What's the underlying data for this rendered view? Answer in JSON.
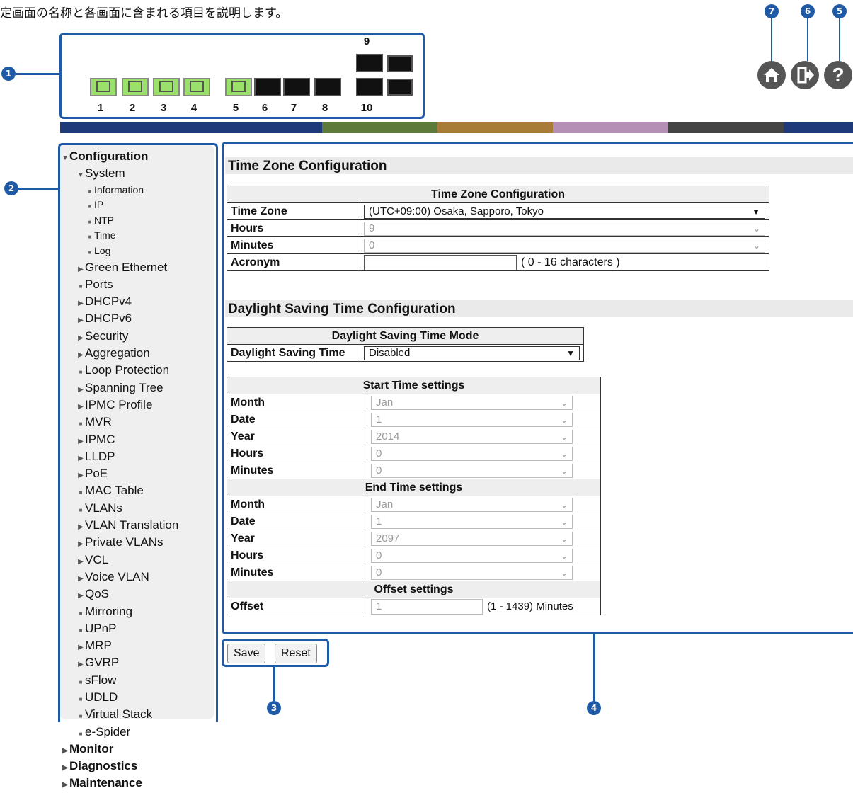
{
  "header_note": "定画面の名称と各画面に含まれる項目を説明します。",
  "callouts": [
    "1",
    "2",
    "3",
    "4",
    "5",
    "6",
    "7"
  ],
  "ports": {
    "labels": [
      "1",
      "2",
      "3",
      "4",
      "5",
      "6",
      "7",
      "8",
      "9",
      "10"
    ],
    "status": [
      "up",
      "up",
      "up",
      "up",
      "up",
      "down",
      "down",
      "down",
      "down",
      "down"
    ]
  },
  "colorbar": [
    "#1f3a78",
    "#1f3a78",
    "#5c7a3a",
    "#a97b39",
    "#b68fb6",
    "#444444",
    "#1f3a78"
  ],
  "header_icons": [
    "home-icon",
    "logout-icon",
    "help-icon"
  ],
  "menu": [
    {
      "label": "Configuration",
      "level": 0,
      "marker": "open"
    },
    {
      "label": "System",
      "level": 1,
      "marker": "open"
    },
    {
      "label": "Information",
      "level": 2,
      "marker": "leaf"
    },
    {
      "label": "IP",
      "level": 2,
      "marker": "leaf"
    },
    {
      "label": "NTP",
      "level": 2,
      "marker": "leaf"
    },
    {
      "label": "Time",
      "level": 2,
      "marker": "leaf"
    },
    {
      "label": "Log",
      "level": 2,
      "marker": "leaf"
    },
    {
      "label": "Green Ethernet",
      "level": 1,
      "marker": "closed"
    },
    {
      "label": "Ports",
      "level": 1,
      "marker": "leaf"
    },
    {
      "label": "DHCPv4",
      "level": 1,
      "marker": "closed"
    },
    {
      "label": "DHCPv6",
      "level": 1,
      "marker": "closed"
    },
    {
      "label": "Security",
      "level": 1,
      "marker": "closed"
    },
    {
      "label": "Aggregation",
      "level": 1,
      "marker": "closed"
    },
    {
      "label": "Loop Protection",
      "level": 1,
      "marker": "leaf"
    },
    {
      "label": "Spanning Tree",
      "level": 1,
      "marker": "closed"
    },
    {
      "label": "IPMC Profile",
      "level": 1,
      "marker": "closed"
    },
    {
      "label": "MVR",
      "level": 1,
      "marker": "leaf"
    },
    {
      "label": "IPMC",
      "level": 1,
      "marker": "closed"
    },
    {
      "label": "LLDP",
      "level": 1,
      "marker": "closed"
    },
    {
      "label": "PoE",
      "level": 1,
      "marker": "closed"
    },
    {
      "label": "MAC Table",
      "level": 1,
      "marker": "leaf"
    },
    {
      "label": "VLANs",
      "level": 1,
      "marker": "leaf"
    },
    {
      "label": "VLAN Translation",
      "level": 1,
      "marker": "closed"
    },
    {
      "label": "Private VLANs",
      "level": 1,
      "marker": "closed"
    },
    {
      "label": "VCL",
      "level": 1,
      "marker": "closed"
    },
    {
      "label": "Voice VLAN",
      "level": 1,
      "marker": "closed"
    },
    {
      "label": "QoS",
      "level": 1,
      "marker": "closed"
    },
    {
      "label": "Mirroring",
      "level": 1,
      "marker": "leaf"
    },
    {
      "label": "UPnP",
      "level": 1,
      "marker": "leaf"
    },
    {
      "label": "MRP",
      "level": 1,
      "marker": "closed"
    },
    {
      "label": "GVRP",
      "level": 1,
      "marker": "closed"
    },
    {
      "label": "sFlow",
      "level": 1,
      "marker": "leaf"
    },
    {
      "label": "UDLD",
      "level": 1,
      "marker": "leaf"
    },
    {
      "label": "Virtual Stack",
      "level": 1,
      "marker": "leaf"
    },
    {
      "label": "e-Spider",
      "level": 1,
      "marker": "leaf"
    },
    {
      "label": "Monitor",
      "level": 0,
      "marker": "closed"
    },
    {
      "label": "Diagnostics",
      "level": 0,
      "marker": "closed"
    },
    {
      "label": "Maintenance",
      "level": 0,
      "marker": "closed"
    }
  ],
  "tz": {
    "section_title": "Time Zone Configuration",
    "table_title": "Time Zone Configuration",
    "time_zone_label": "Time Zone",
    "time_zone_value": "(UTC+09:00) Osaka, Sapporo, Tokyo",
    "hours_label": "Hours",
    "hours_value": "9",
    "minutes_label": "Minutes",
    "minutes_value": "0",
    "acronym_label": "Acronym",
    "acronym_value": "",
    "acronym_hint": "( 0 - 16 characters )"
  },
  "dst": {
    "section_title": "Daylight Saving Time Configuration",
    "mode_title": "Daylight Saving Time Mode",
    "dst_label": "Daylight Saving Time",
    "dst_value": "Disabled",
    "start_title": "Start Time settings",
    "end_title": "End Time settings",
    "offset_title": "Offset settings",
    "month_label": "Month",
    "date_label": "Date",
    "year_label": "Year",
    "hours_label": "Hours",
    "minutes_label": "Minutes",
    "start": {
      "month": "Jan",
      "date": "1",
      "year": "2014",
      "hours": "0",
      "minutes": "0"
    },
    "end": {
      "month": "Jan",
      "date": "1",
      "year": "2097",
      "hours": "0",
      "minutes": "0"
    },
    "offset_label": "Offset",
    "offset_value": "1",
    "offset_hint": "(1 - 1439) Minutes"
  },
  "buttons": {
    "save": "Save",
    "reset": "Reset"
  }
}
